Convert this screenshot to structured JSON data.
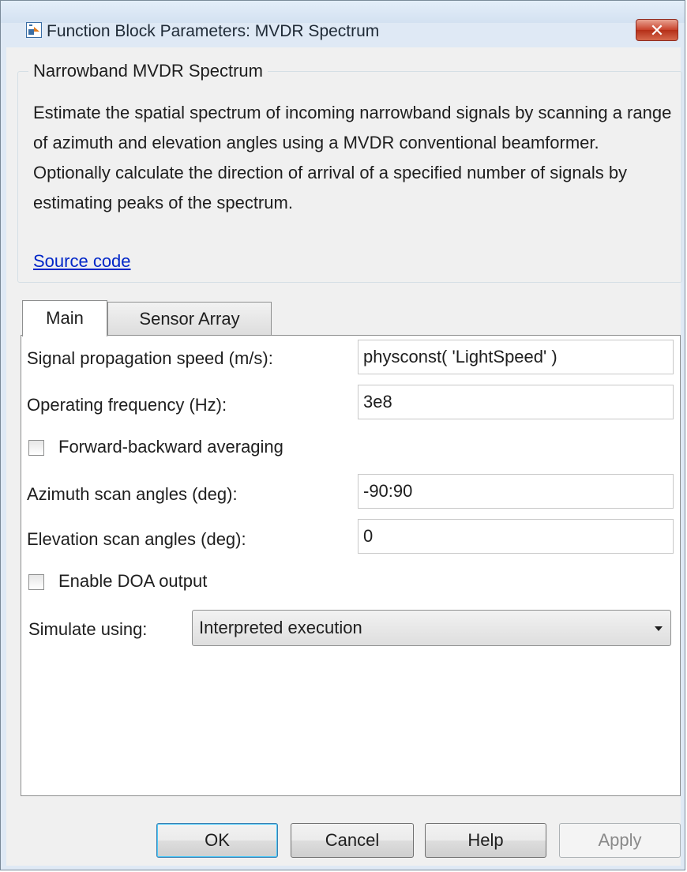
{
  "window": {
    "title": "Function Block Parameters: MVDR Spectrum",
    "close_label": "✕"
  },
  "group": {
    "title": "Narrowband MVDR Spectrum",
    "description": "Estimate the spatial spectrum of incoming narrowband signals by scanning a range of azimuth and elevation angles using a MVDR conventional beamformer. Optionally calculate the direction of arrival of a specified number of signals by estimating peaks of the spectrum.",
    "link_label": "Source code"
  },
  "tabs": [
    {
      "label": "Main",
      "selected": true
    },
    {
      "label": "Sensor Array",
      "selected": false
    }
  ],
  "params": {
    "propagation_speed_label": "Signal propagation speed (m/s):",
    "propagation_speed_value": "physconst( 'LightSpeed' )",
    "operating_freq_label": "Operating frequency (Hz):",
    "operating_freq_value": "3e8",
    "fb_averaging_label": "Forward-backward averaging",
    "fb_averaging_checked": false,
    "azimuth_label": "Azimuth scan angles (deg):",
    "azimuth_value": "-90:90",
    "elevation_label": "Elevation scan angles (deg):",
    "elevation_value": "0",
    "doa_label": "Enable DOA output",
    "doa_checked": false,
    "simulate_label": "Simulate using:",
    "simulate_value": "Interpreted execution"
  },
  "buttons": {
    "ok": "OK",
    "cancel": "Cancel",
    "help": "Help",
    "apply": "Apply"
  },
  "colors": {
    "link": "#0026c8",
    "close_button": "#c8412a",
    "ok_focus": "#48c8f8"
  }
}
